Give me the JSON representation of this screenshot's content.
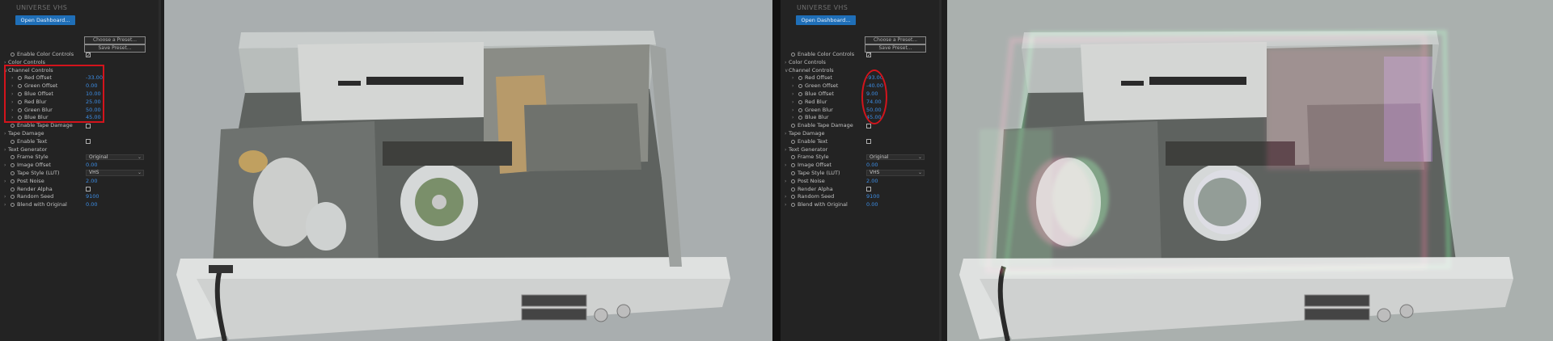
{
  "left": {
    "panel": {
      "title": "UNIVERSE VHS",
      "open_dashboard": "Open Dashboard...",
      "choose_preset": "Choose a Preset...",
      "save_preset": "Save Preset...",
      "rows": [
        {
          "name": "enable-color-controls",
          "label": "Enable Color Controls",
          "type": "checkbox",
          "checked": true,
          "indent": 0,
          "twirl": false,
          "stopwatch": true
        },
        {
          "name": "color-controls",
          "label": "Color Controls",
          "type": "group",
          "indent": 0,
          "twirl": true,
          "stopwatch": false
        },
        {
          "name": "channel-controls",
          "label": "Channel Controls",
          "type": "group",
          "open": true,
          "indent": 0,
          "twirl": true,
          "stopwatch": false
        },
        {
          "name": "red-offset",
          "label": "Red Offset",
          "type": "value",
          "value": "-33.00",
          "indent": 1,
          "twirl": true,
          "stopwatch": true
        },
        {
          "name": "green-offset",
          "label": "Green Offset",
          "type": "value",
          "value": "0.00",
          "indent": 1,
          "twirl": true,
          "stopwatch": true
        },
        {
          "name": "blue-offset",
          "label": "Blue Offset",
          "type": "value",
          "value": "10.00",
          "indent": 1,
          "twirl": true,
          "stopwatch": true
        },
        {
          "name": "red-blur",
          "label": "Red Blur",
          "type": "value",
          "value": "25.00",
          "indent": 1,
          "twirl": true,
          "stopwatch": true
        },
        {
          "name": "green-blur",
          "label": "Green Blur",
          "type": "value",
          "value": "50.00",
          "indent": 1,
          "twirl": true,
          "stopwatch": true
        },
        {
          "name": "blue-blur",
          "label": "Blue Blur",
          "type": "value",
          "value": "45.00",
          "indent": 1,
          "twirl": true,
          "stopwatch": true
        },
        {
          "name": "enable-tape-damage",
          "label": "Enable Tape Damage",
          "type": "checkbox",
          "checked": false,
          "indent": 0,
          "twirl": false,
          "stopwatch": true
        },
        {
          "name": "tape-damage",
          "label": "Tape Damage",
          "type": "group",
          "indent": 0,
          "twirl": true,
          "stopwatch": false
        },
        {
          "name": "enable-text",
          "label": "Enable Text",
          "type": "checkbox",
          "checked": false,
          "indent": 0,
          "twirl": false,
          "stopwatch": true
        },
        {
          "name": "text-generator",
          "label": "Text Generator",
          "type": "group",
          "indent": 0,
          "twirl": true,
          "stopwatch": false
        },
        {
          "name": "frame-style",
          "label": "Frame Style",
          "type": "select",
          "value": "Original",
          "indent": 0,
          "twirl": false,
          "stopwatch": true
        },
        {
          "name": "image-offset",
          "label": "Image Offset",
          "type": "value",
          "value": "0.00",
          "indent": 0,
          "twirl": true,
          "stopwatch": true
        },
        {
          "name": "tape-style",
          "label": "Tape Style (LUT)",
          "type": "select",
          "value": "VHS",
          "indent": 0,
          "twirl": false,
          "stopwatch": true
        },
        {
          "name": "post-noise",
          "label": "Post Noise",
          "type": "value",
          "value": "2.00",
          "indent": 0,
          "twirl": true,
          "stopwatch": true
        },
        {
          "name": "render-alpha",
          "label": "Render Alpha",
          "type": "checkbox",
          "checked": false,
          "indent": 0,
          "twirl": false,
          "stopwatch": true
        },
        {
          "name": "random-seed",
          "label": "Random Seed",
          "type": "value",
          "value": "9100",
          "indent": 0,
          "twirl": true,
          "stopwatch": true
        },
        {
          "name": "blend-with-original",
          "label": "Blend with Original",
          "type": "value",
          "value": "0.00",
          "indent": 0,
          "twirl": true,
          "stopwatch": true
        }
      ]
    }
  },
  "right": {
    "panel": {
      "title": "UNIVERSE VHS",
      "open_dashboard": "Open Dashboard...",
      "choose_preset": "Choose a Preset...",
      "save_preset": "Save Preset...",
      "rows": [
        {
          "name": "enable-color-controls",
          "label": "Enable Color Controls",
          "type": "checkbox",
          "checked": true,
          "indent": 0,
          "twirl": false,
          "stopwatch": true
        },
        {
          "name": "color-controls",
          "label": "Color Controls",
          "type": "group",
          "indent": 0,
          "twirl": true,
          "stopwatch": false
        },
        {
          "name": "channel-controls",
          "label": "Channel Controls",
          "type": "group",
          "open": true,
          "indent": 0,
          "twirl": true,
          "stopwatch": false
        },
        {
          "name": "red-offset",
          "label": "Red Offset",
          "type": "value",
          "value": "-93.00",
          "indent": 1,
          "twirl": true,
          "stopwatch": true
        },
        {
          "name": "green-offset",
          "label": "Green Offset",
          "type": "value",
          "value": "-40.00",
          "indent": 1,
          "twirl": true,
          "stopwatch": true
        },
        {
          "name": "blue-offset",
          "label": "Blue Offset",
          "type": "value",
          "value": "9.00",
          "indent": 1,
          "twirl": true,
          "stopwatch": true
        },
        {
          "name": "red-blur",
          "label": "Red Blur",
          "type": "value",
          "value": "74.00",
          "indent": 1,
          "twirl": true,
          "stopwatch": true
        },
        {
          "name": "green-blur",
          "label": "Green Blur",
          "type": "value",
          "value": "50.00",
          "indent": 1,
          "twirl": true,
          "stopwatch": true
        },
        {
          "name": "blue-blur",
          "label": "Blue Blur",
          "type": "value",
          "value": "45.00",
          "indent": 1,
          "twirl": true,
          "stopwatch": true
        },
        {
          "name": "enable-tape-damage",
          "label": "Enable Tape Damage",
          "type": "checkbox",
          "checked": false,
          "indent": 0,
          "twirl": false,
          "stopwatch": true
        },
        {
          "name": "tape-damage",
          "label": "Tape Damage",
          "type": "group",
          "indent": 0,
          "twirl": true,
          "stopwatch": false
        },
        {
          "name": "enable-text",
          "label": "Enable Text",
          "type": "checkbox",
          "checked": false,
          "indent": 0,
          "twirl": false,
          "stopwatch": true
        },
        {
          "name": "text-generator",
          "label": "Text Generator",
          "type": "group",
          "indent": 0,
          "twirl": true,
          "stopwatch": false
        },
        {
          "name": "frame-style",
          "label": "Frame Style",
          "type": "select",
          "value": "Original",
          "indent": 0,
          "twirl": false,
          "stopwatch": true
        },
        {
          "name": "image-offset",
          "label": "Image Offset",
          "type": "value",
          "value": "0.00",
          "indent": 0,
          "twirl": true,
          "stopwatch": true
        },
        {
          "name": "tape-style",
          "label": "Tape Style (LUT)",
          "type": "select",
          "value": "VHS",
          "indent": 0,
          "twirl": false,
          "stopwatch": true
        },
        {
          "name": "post-noise",
          "label": "Post Noise",
          "type": "value",
          "value": "2.00",
          "indent": 0,
          "twirl": true,
          "stopwatch": true
        },
        {
          "name": "render-alpha",
          "label": "Render Alpha",
          "type": "checkbox",
          "checked": false,
          "indent": 0,
          "twirl": false,
          "stopwatch": true
        },
        {
          "name": "random-seed",
          "label": "Random Seed",
          "type": "value",
          "value": "9100",
          "indent": 0,
          "twirl": true,
          "stopwatch": true
        },
        {
          "name": "blend-with-original",
          "label": "Blend with Original",
          "type": "value",
          "value": "0.00",
          "indent": 0,
          "twirl": true,
          "stopwatch": true
        }
      ]
    }
  },
  "colors": {
    "panel_bg": "#232323",
    "accent_blue": "#1f6fb8",
    "value_blue": "#3d8ee6",
    "highlight_red": "#d3141c",
    "viewer_bg": "#a9aeaf"
  }
}
